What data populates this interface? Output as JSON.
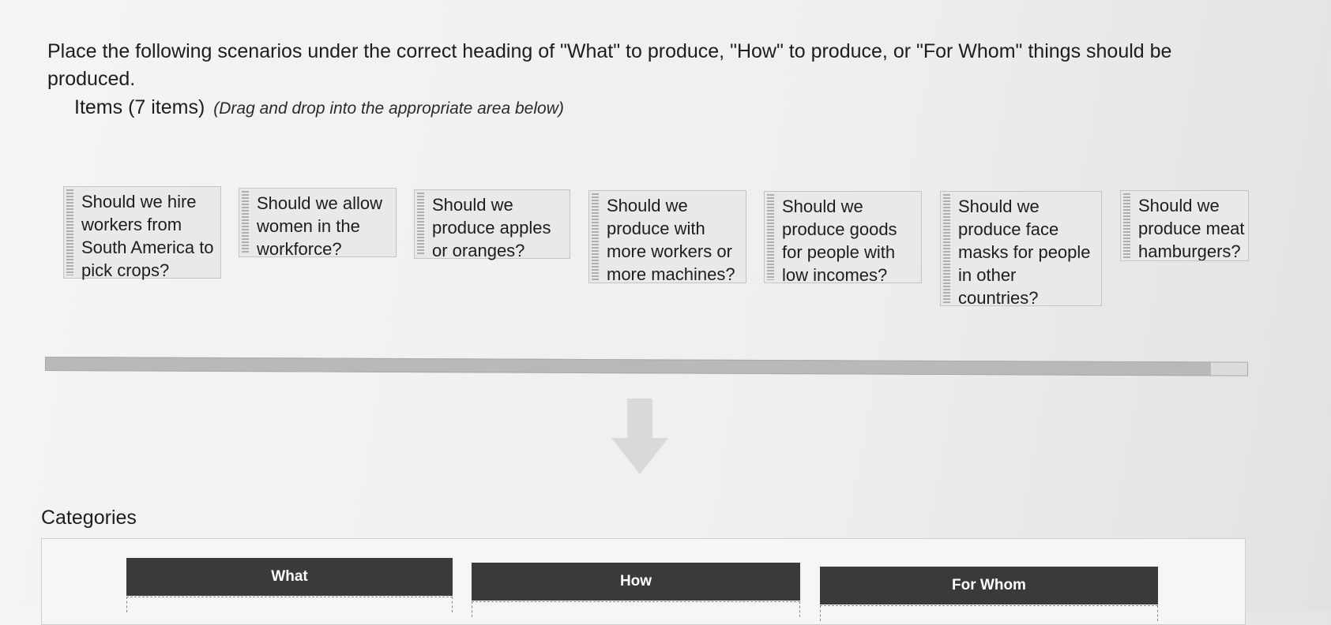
{
  "instructions": "Place the following scenarios under the correct heading of \"What\" to produce, \"How\" to produce, or \"For Whom\" things should be produced.",
  "items_heading": {
    "label": "Items (7 items)",
    "note": "(Drag and drop into the appropriate area below)"
  },
  "items": [
    {
      "lines": [
        "Should we hire",
        "workers from",
        "South America to",
        "pick crops?"
      ]
    },
    {
      "lines": [
        "Should we allow",
        "women in the",
        "workforce?"
      ]
    },
    {
      "lines": [
        "Should we",
        "produce apples",
        "or oranges?"
      ]
    },
    {
      "lines": [
        "Should we",
        "produce with",
        "more workers or",
        "more machines?"
      ]
    },
    {
      "lines": [
        "Should we",
        "produce goods",
        "for people with",
        "low incomes?"
      ]
    },
    {
      "lines": [
        "Should we",
        "produce face",
        "masks for people",
        "in other",
        "countries?"
      ]
    },
    {
      "lines": [
        "Should we",
        "produce meat",
        "hamburgers?"
      ]
    }
  ],
  "drop_hint_icon": "down-arrow-icon",
  "categories": {
    "title": "Categories",
    "headers": [
      "What",
      "How",
      "For Whom"
    ]
  },
  "colors": {
    "category_header_bg": "#3a3a3a",
    "item_bg": "#e9e9e9"
  }
}
